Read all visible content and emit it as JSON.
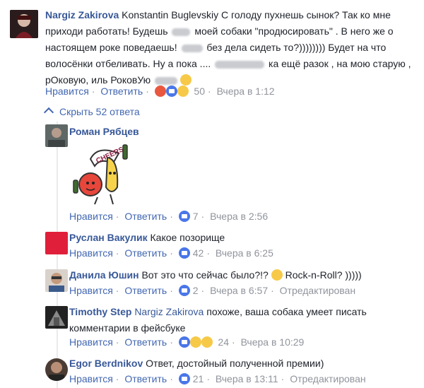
{
  "main_comment": {
    "author": "Nargiz Zakirova",
    "line1_rest": " Konstantin Buglevskiy С голоду пухнешь сынок? Так ко мне",
    "line2_a": "приходи работать! Будешь ",
    "line2_b": " моей собаки \"продюсировать\" . В него же о",
    "line3_a": "настоящем роке поведаешь! ",
    "line3_b": " без дела сидеть то?)))))))) Будет на что",
    "line4_a": "волосёнки отбеливать. Ну а пока .... ",
    "line4_b": " ка ещё разок , на мою старую ,",
    "line5_a": "рОковую, иль РоковУю ",
    "like_label": "Нравится",
    "reply_label": "Ответить",
    "reaction_count": "50",
    "timestamp": "Вчера в 1:12"
  },
  "hide_replies_label": "Скрыть 52 ответа",
  "replies": [
    {
      "author": "Роман Рябцев",
      "text": "",
      "like_label": "Нравится",
      "reply_label": "Ответить",
      "count": "7",
      "time": "Вчера в 2:56",
      "edited": ""
    },
    {
      "author": "Руслан Вакулик",
      "text": "Какое позорище",
      "like_label": "Нравится",
      "reply_label": "Ответить",
      "count": "42",
      "time": "Вчера в 6:25",
      "edited": ""
    },
    {
      "author": "Данила Юшин",
      "text": "Вот это что сейчас было?!? ",
      "text2": " Rock-n-Roll? )))))",
      "like_label": "Нравится",
      "reply_label": "Ответить",
      "count": "2",
      "time": "Вчера в 6:57",
      "edited": "Отредактирован"
    },
    {
      "author": "Timothy Step",
      "mention": "Nargiz Zakirova",
      "text": " похоже, ваша собака умеет писать",
      "text_line2": "комментарии в фейсбуке",
      "like_label": "Нравится",
      "reply_label": "Ответить",
      "count": "24",
      "time": "Вчера в 10:29",
      "edited": ""
    },
    {
      "author": "Egor Berdnikov",
      "text": "Ответ, достойный полученной премии)",
      "like_label": "Нравится",
      "reply_label": "Ответить",
      "count": "21",
      "time": "Вчера в 13:11",
      "edited": "Отредактирован"
    }
  ],
  "sticker_text": "CHEERS!"
}
